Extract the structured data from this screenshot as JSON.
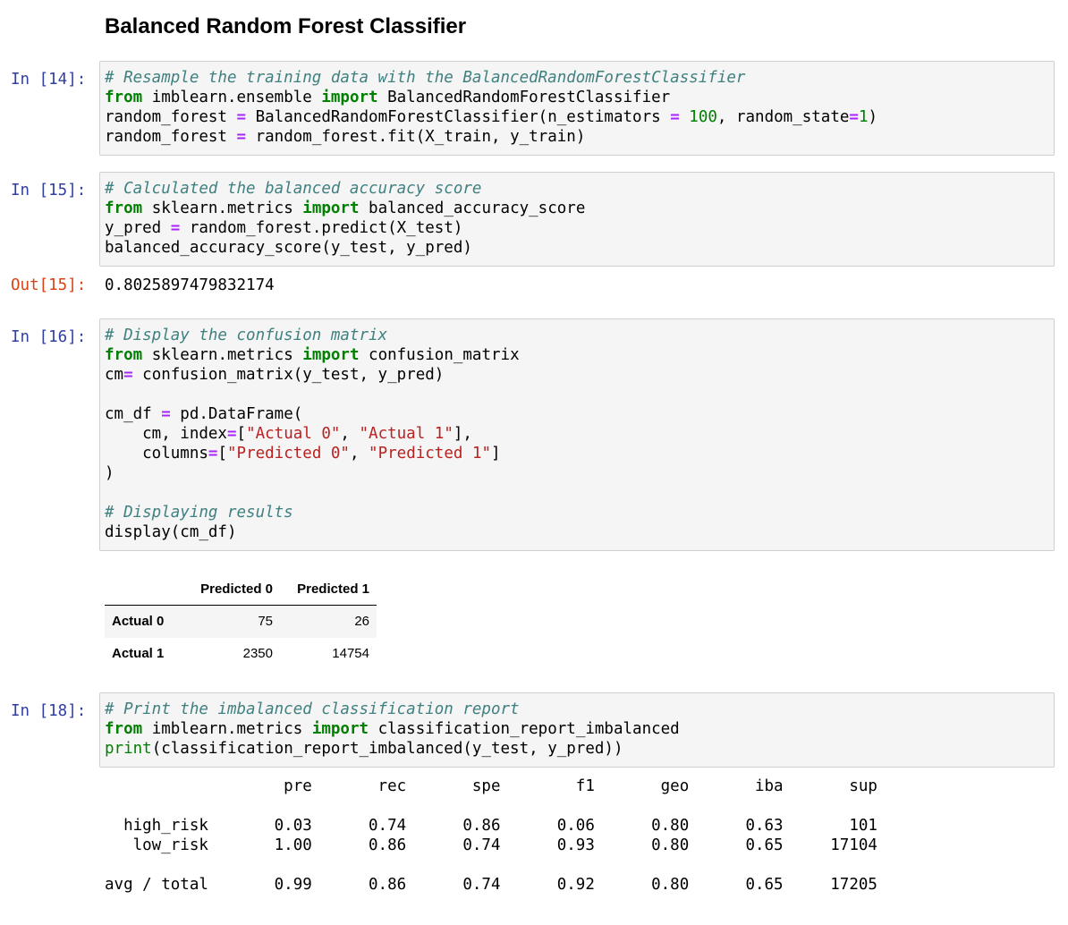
{
  "heading": "Balanced Random Forest Classifier",
  "cells": {
    "c14": {
      "prompt": "In [14]:",
      "lines": [
        "# Resample the training data with the BalancedRandomForestClassifier",
        "from imblearn.ensemble import BalancedRandomForestClassifier",
        "random_forest = BalancedRandomForestClassifier(n_estimators = 100, random_state=1)",
        "random_forest = random_forest.fit(X_train, y_train)"
      ]
    },
    "c15": {
      "prompt": "In [15]:",
      "lines": [
        "# Calculated the balanced accuracy score",
        "from sklearn.metrics import balanced_accuracy_score",
        "y_pred = random_forest.predict(X_test)",
        "balanced_accuracy_score(y_test, y_pred)"
      ],
      "out_prompt": "Out[15]:",
      "output": "0.8025897479832174"
    },
    "c16": {
      "prompt": "In [16]:",
      "lines": [
        "# Display the confusion matrix",
        "from sklearn.metrics import confusion_matrix",
        "cm= confusion_matrix(y_test, y_pred)",
        "",
        "cm_df = pd.DataFrame(",
        "    cm, index=[\"Actual 0\", \"Actual 1\"],",
        "    columns=[\"Predicted 0\", \"Predicted 1\"]",
        ")",
        "",
        "# Displaying results",
        "display(cm_df)"
      ]
    },
    "c18": {
      "prompt": "In [18]:",
      "lines": [
        "# Print the imbalanced classification report",
        "from imblearn.metrics import classification_report_imbalanced",
        "print(classification_report_imbalanced(y_test, y_pred))"
      ]
    }
  },
  "confusion_table": {
    "columns": [
      "Predicted 0",
      "Predicted 1"
    ],
    "rows": [
      {
        "label": "Actual 0",
        "values": [
          "75",
          "26"
        ]
      },
      {
        "label": "Actual 1",
        "values": [
          "2350",
          "14754"
        ]
      }
    ]
  },
  "report": {
    "header": "                   pre       rec       spe        f1       geo       iba       sup",
    "lines": [
      "",
      "  high_risk       0.03      0.74      0.86      0.06      0.80      0.63       101",
      "   low_risk       1.00      0.86      0.74      0.93      0.80      0.65     17104",
      "",
      "avg / total       0.99      0.86      0.74      0.92      0.80      0.65     17205"
    ]
  },
  "colors": {
    "in_prompt": "#303f9f",
    "out_prompt": "#d84315",
    "cell_bg": "#f5f5f5",
    "comment": "#408080",
    "keyword": "#008000",
    "operator": "#aa22ff",
    "string": "#ba2121"
  }
}
